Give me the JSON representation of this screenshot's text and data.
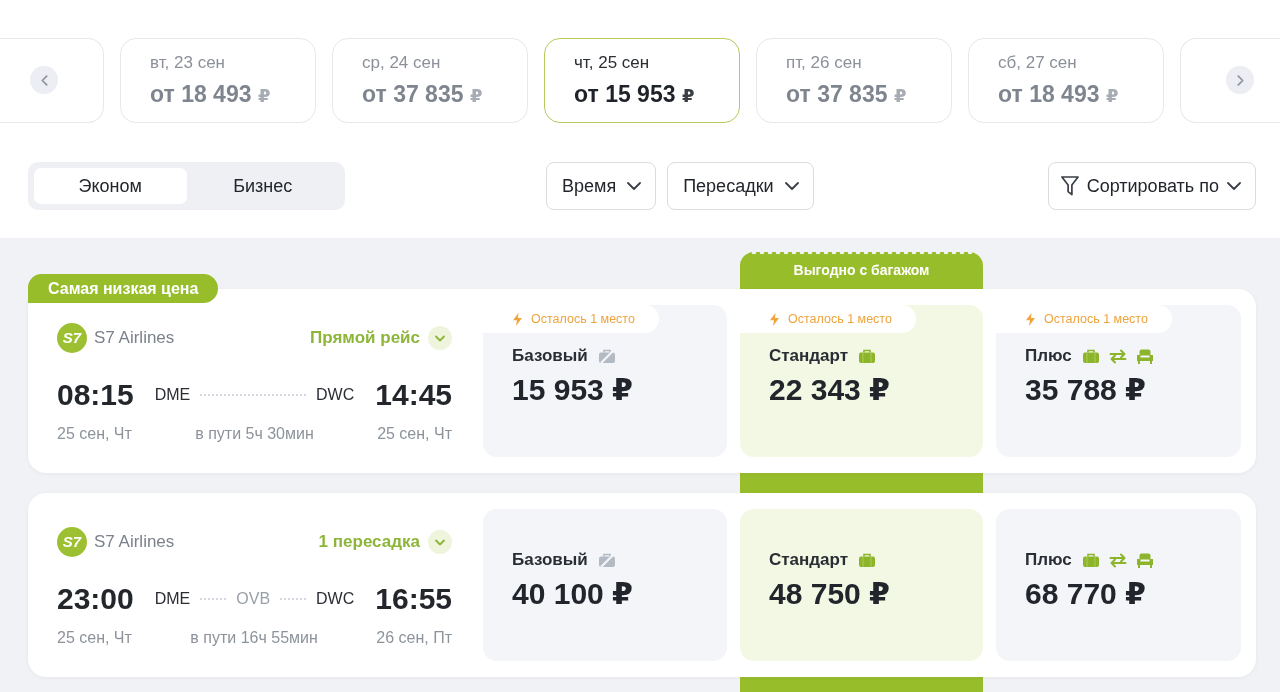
{
  "date_strip": [
    {
      "date": "вт, 23 сен",
      "price": "от 18 493",
      "currency": "₽",
      "selected": false
    },
    {
      "date": "ср, 24 сен",
      "price": "от 37 835",
      "currency": "₽",
      "selected": false
    },
    {
      "date": "чт, 25 сен",
      "price": "от 15 953",
      "currency": "₽",
      "selected": true
    },
    {
      "date": "пт, 26 сен",
      "price": "от 37 835",
      "currency": "₽",
      "selected": false
    },
    {
      "date": "сб, 27 сен",
      "price": "от 18 493",
      "currency": "₽",
      "selected": false
    }
  ],
  "cabin_tabs": [
    {
      "label": "Эконом",
      "selected": true
    },
    {
      "label": "Бизнес",
      "selected": false
    }
  ],
  "filters": [
    {
      "label": "Время"
    },
    {
      "label": "Пересадки"
    }
  ],
  "sort": {
    "label": "Сортировать по"
  },
  "featured_column": {
    "label": "Выгодно с багажом"
  },
  "flights": [
    {
      "badge": "Самая низкая цена",
      "logo": "S7",
      "airline": "S7 Airlines",
      "stops": "Прямой рейс",
      "departure": {
        "time": "08:15",
        "airport": "DME",
        "date": "25 сен, Чт"
      },
      "arrival": {
        "time": "14:45",
        "airport": "DWC",
        "date": "25 сен, Чт"
      },
      "duration": "в пути 5ч 30мин",
      "fares": [
        {
          "kind": "basic",
          "name": "Базовый",
          "price": "15 953 ₽",
          "seats_left": "Осталось 1 место",
          "featured": false
        },
        {
          "kind": "standard",
          "name": "Стандарт",
          "price": "22 343 ₽",
          "seats_left": "Осталось 1 место",
          "featured": true
        },
        {
          "kind": "plus",
          "name": "Плюс",
          "price": "35 788 ₽",
          "seats_left": "Осталось 1 место",
          "featured": false
        }
      ]
    },
    {
      "logo": "S7",
      "airline": "S7 Airlines",
      "stops": "1 пересадка",
      "departure": {
        "time": "23:00",
        "airport": "DME",
        "date": "25 сен, Чт"
      },
      "stopover": "OVB",
      "arrival": {
        "time": "16:55",
        "airport": "DWC",
        "date": "26 сен, Пт"
      },
      "duration": "в пути 16ч 55мин",
      "fares": [
        {
          "kind": "basic",
          "name": "Базовый",
          "price": "40 100 ₽",
          "featured": false
        },
        {
          "kind": "standard",
          "name": "Стандарт",
          "price": "48 750 ₽",
          "featured": true
        },
        {
          "kind": "plus",
          "name": "Плюс",
          "price": "68 770 ₽",
          "featured": false
        }
      ]
    }
  ]
}
